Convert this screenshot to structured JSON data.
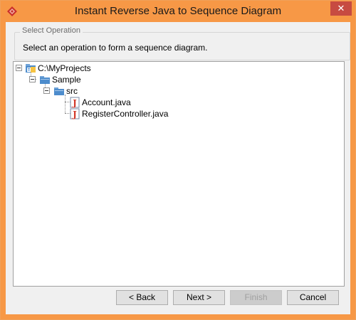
{
  "window": {
    "title": "Instant Reverse Java to Sequence Diagram",
    "close_glyph": "✕"
  },
  "select_operation": {
    "group_title": "Select Operation",
    "description": "Select an operation to form a sequence diagram."
  },
  "tree": {
    "root": {
      "label": "C:\\MyProjects",
      "icon": "project-folder-icon"
    },
    "sample": {
      "label": "Sample",
      "icon": "folder-icon"
    },
    "src": {
      "label": "src",
      "icon": "folder-icon"
    },
    "files": [
      {
        "label": "Account.java",
        "icon": "java-file-icon"
      },
      {
        "label": "RegisterController.java",
        "icon": "java-file-icon"
      }
    ]
  },
  "buttons": {
    "back": "< Back",
    "next": "Next >",
    "finish": "Finish",
    "cancel": "Cancel"
  },
  "colors": {
    "titlebar": "#f79846",
    "close": "#c74b41",
    "java_icon_red": "#d33a2c",
    "folder_blue": "#4d8ccc"
  }
}
